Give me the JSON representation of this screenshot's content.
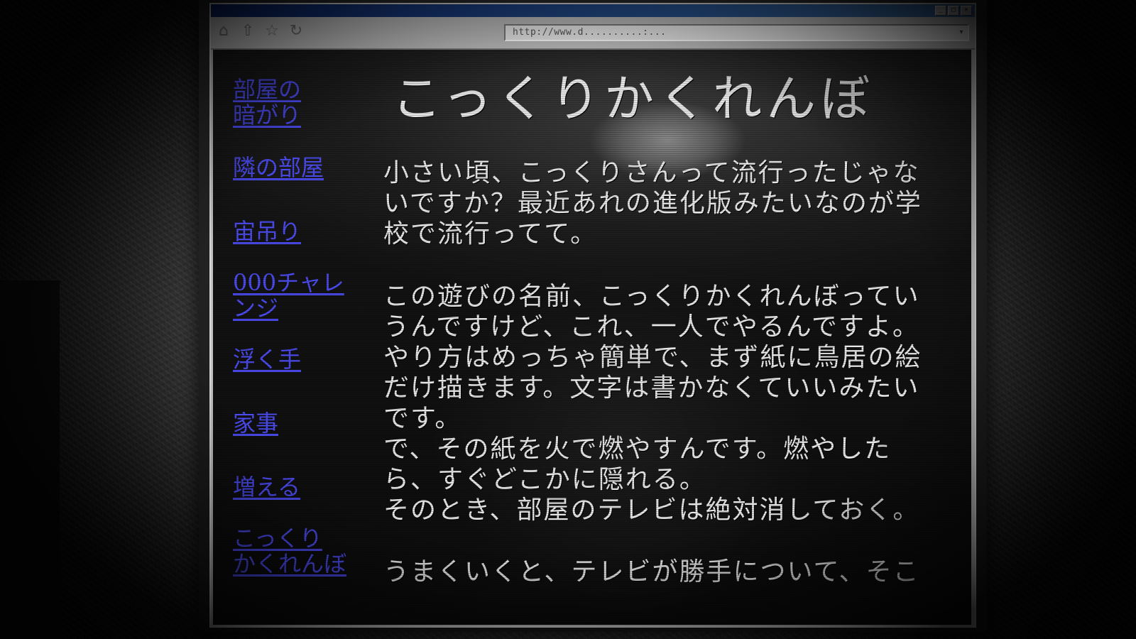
{
  "browser": {
    "url": "http://www.d..........:...",
    "nav_icons": [
      "home-icon",
      "up-icon",
      "favorite-icon",
      "refresh-icon"
    ],
    "window_buttons": [
      "_",
      "□",
      "×"
    ]
  },
  "sidebar": {
    "links": [
      {
        "id": "room-dark",
        "lines": [
          "部屋の",
          "暗がり"
        ]
      },
      {
        "id": "next-room",
        "lines": [
          "隣の部屋"
        ]
      },
      {
        "id": "hanging",
        "lines": [
          "宙吊り"
        ]
      },
      {
        "id": "challenge",
        "lines": [
          "000チャレ",
          "ンジ"
        ]
      },
      {
        "id": "floating-hand",
        "lines": [
          "浮く手"
        ]
      },
      {
        "id": "housework",
        "lines": [
          "家事"
        ]
      },
      {
        "id": "increase",
        "lines": [
          "増える"
        ]
      },
      {
        "id": "kokkuri",
        "lines": [
          "こっくり",
          "かくれんぼ"
        ]
      }
    ]
  },
  "article": {
    "title": "こっくりかくれんぼ",
    "paragraphs": [
      [
        "小さい頃、こっくりさんって流行ったじゃな",
        "いですか？最近あれの進化版みたいなのが学",
        "校で流行ってて。"
      ],
      [
        "この遊びの名前、こっくりかくれんぼってい",
        "うんですけど、これ、一人でやるんですよ。",
        "やり方はめっちゃ簡単で、まず紙に鳥居の絵",
        "だけ描きます。文字は書かなくていいみたい",
        "です。",
        "で、その紙を火で燃やすんです。燃やした",
        "ら、すぐどこかに隠れる。",
        "そのとき、部屋のテレビは絶対消しておく。"
      ],
      [
        "うまくいくと、テレビが勝手について、そこ"
      ]
    ]
  },
  "colors": {
    "link": "#4b4bf0",
    "text": "#e6e6e6",
    "page_bg": "#050505",
    "titlebar": "#0a246a"
  }
}
